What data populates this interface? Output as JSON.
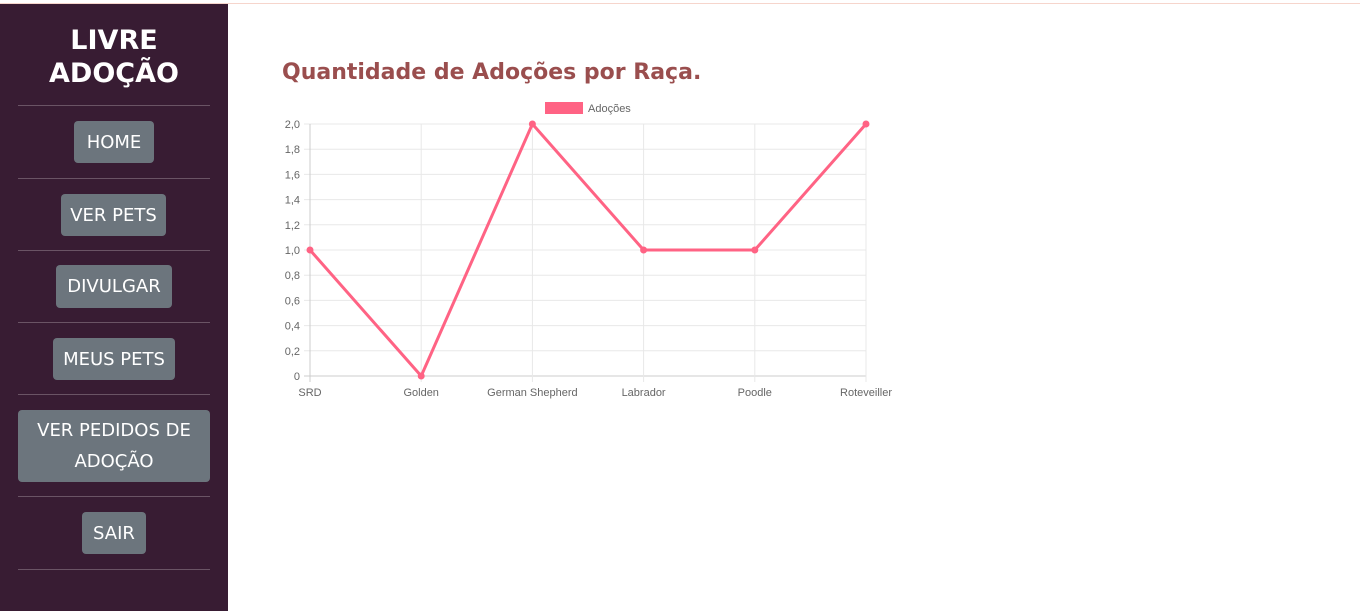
{
  "sidebar": {
    "brand": "LIVRE ADOÇÃO",
    "nav": {
      "home": "HOME",
      "ver_pets": "VER PETS",
      "divulgar": "DIVULGAR",
      "meus_pets": "MEUS PETS",
      "ver_pedidos": "VER PEDIDOS DE ADOÇÃO",
      "sair": "SAIR"
    },
    "colors": {
      "background": "#381c33",
      "button": "#6c757d"
    }
  },
  "main": {
    "title": "Quantidade de Adoções por Raça."
  },
  "chart_data": {
    "type": "line",
    "categories": [
      "SRD",
      "Golden",
      "German Shepherd",
      "Labrador",
      "Poodle",
      "Roteveiller"
    ],
    "series": [
      {
        "name": "Adoções",
        "values": [
          1,
          0,
          2,
          1,
          1,
          2
        ],
        "color": "#ff6384"
      }
    ],
    "yticks": [
      "0",
      "0,2",
      "0,4",
      "0,6",
      "0,8",
      "1,0",
      "1,2",
      "1,4",
      "1,6",
      "1,8",
      "2,0"
    ],
    "ylim": [
      0,
      2
    ],
    "grid": true,
    "legend": "top"
  }
}
